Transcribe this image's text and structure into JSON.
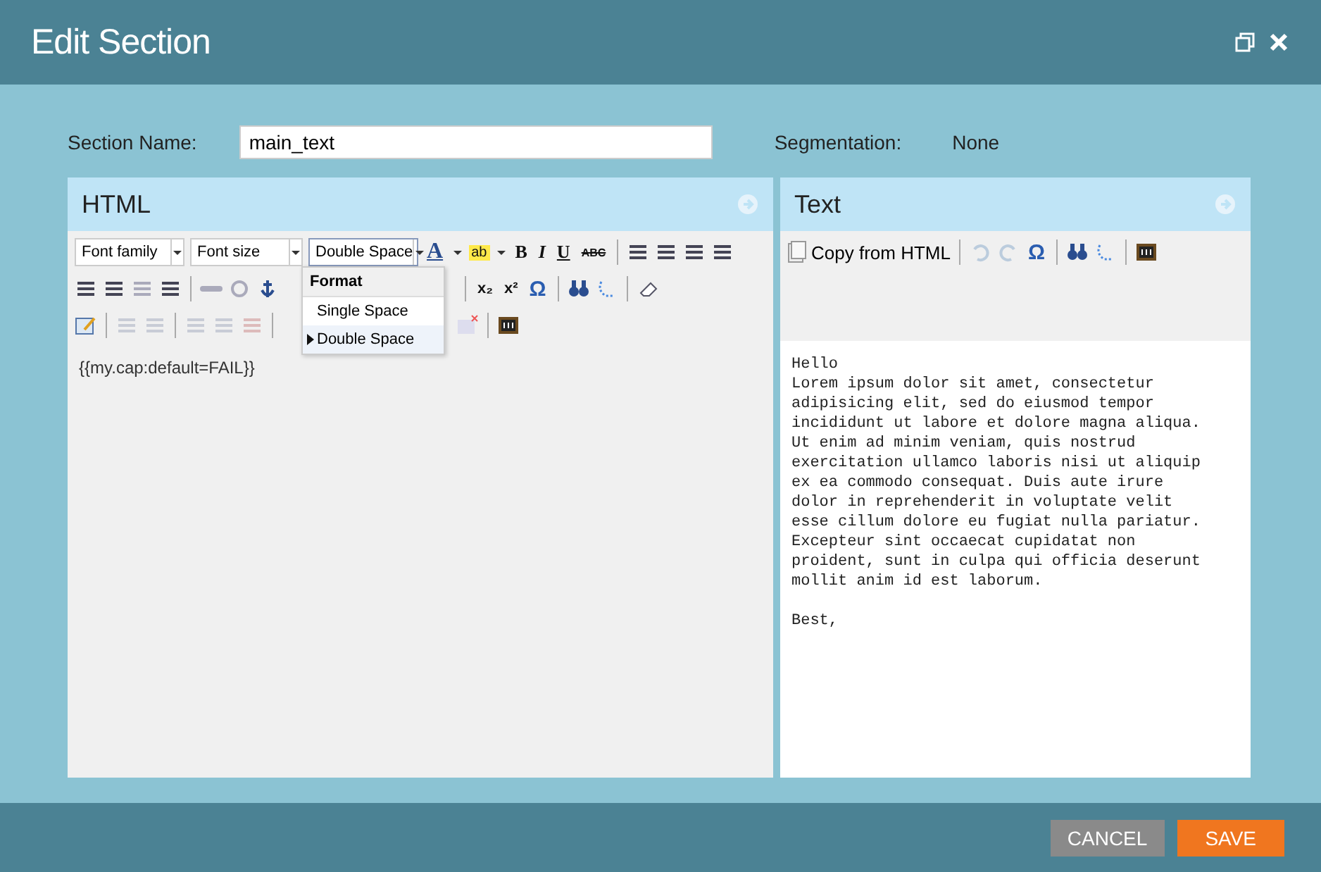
{
  "window": {
    "title": "Edit Section"
  },
  "section_name": {
    "label": "Section Name:",
    "value": "main_text"
  },
  "segmentation": {
    "label": "Segmentation:",
    "value": "None"
  },
  "html_panel": {
    "title": "HTML",
    "selects": [
      {
        "label": "Font family",
        "open": false
      },
      {
        "label": "Font size",
        "open": false
      },
      {
        "label": "Double Space",
        "open": true
      }
    ],
    "glyphs": [
      "A",
      "ab",
      "B",
      "I",
      "U",
      "ABC",
      "x₂",
      "x²",
      "Ω"
    ],
    "format_menu": {
      "header": "Format",
      "items": [
        {
          "label": "Single Space",
          "selected": false
        },
        {
          "label": "Double Space",
          "selected": true
        }
      ]
    },
    "content": "{{my.cap:default=FAIL}}"
  },
  "text_panel": {
    "title": "Text",
    "copy_button": "Copy from HTML",
    "glyph": "Ω",
    "content": "Hello\nLorem ipsum dolor sit amet, consectetur\nadipisicing elit, sed do eiusmod tempor\nincididunt ut labore et dolore magna aliqua.\nUt enim ad minim veniam, quis nostrud\nexercitation ullamco laboris nisi ut aliquip\nex ea commodo consequat. Duis aute irure\ndolor in reprehenderit in voluptate velit\nesse cillum dolore eu fugiat nulla pariatur.\nExcepteur sint occaecat cupidatat non\nproident, sunt in culpa qui officia deserunt\nmollit anim id est laborum.\n\nBest,"
  },
  "buttons": [
    {
      "label": "CANCEL",
      "kind": "secondary"
    },
    {
      "label": "SAVE",
      "kind": "primary"
    }
  ]
}
